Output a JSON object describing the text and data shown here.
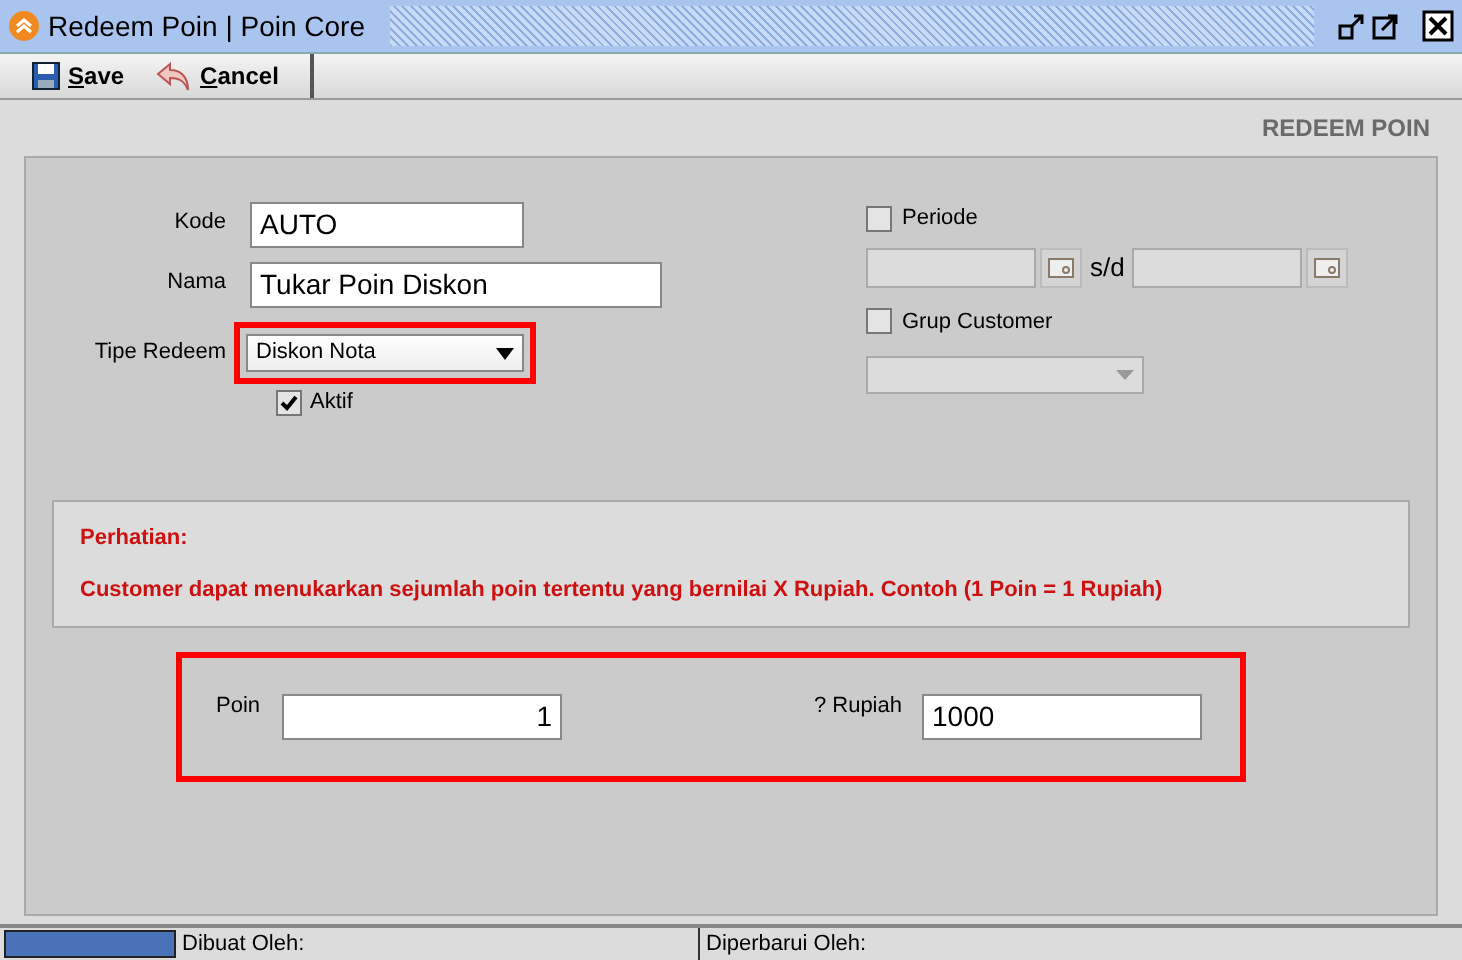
{
  "window": {
    "title": "Redeem Poin | Poin Core"
  },
  "toolbar": [
    {
      "label": "Save",
      "kind": "save"
    },
    {
      "label": "Cancel",
      "kind": "cancel"
    }
  ],
  "heading": "REDEEM POIN",
  "form": {
    "kode": {
      "label": "Kode",
      "value": "AUTO"
    },
    "nama": {
      "label": "Nama",
      "value": "Tukar Poin Diskon"
    },
    "tipe_redeem": {
      "label": "Tipe Redeem",
      "value": "Diskon Nota",
      "highlighted": true
    },
    "aktif": {
      "label": "Aktif",
      "checked": true
    }
  },
  "periode": {
    "label": "Periode",
    "checked": false,
    "separator": "s/d"
  },
  "grup_customer": {
    "label": "Grup Customer",
    "checked": false
  },
  "notice": {
    "title": "Perhatian:",
    "text": "Customer dapat menukarkan sejumlah poin tertentu yang bernilai X Rupiah. Contoh (1 Poin = 1 Rupiah)"
  },
  "conversion": {
    "highlighted": true,
    "poin": {
      "label": "Poin",
      "value": "1"
    },
    "rupiah": {
      "label": "? Rupiah",
      "value": "1000"
    }
  },
  "status_bar": {
    "created_by": "Dibuat Oleh:",
    "updated_by": "Diperbarui Oleh:"
  }
}
